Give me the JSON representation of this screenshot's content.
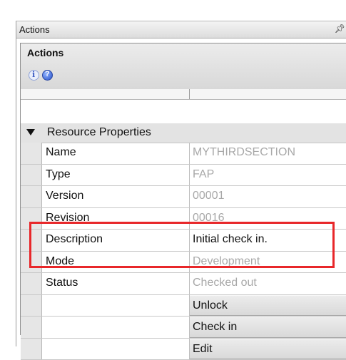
{
  "window": {
    "title": "Actions",
    "pin_icon": "pin-icon"
  },
  "panel": {
    "title": "Actions",
    "toolbar_icons": [
      "info-icon",
      "help-icon"
    ]
  },
  "category": {
    "label": "Resource Properties",
    "expanded": true
  },
  "properties": [
    {
      "name": "Name",
      "value": "MYTHIRDSECTION"
    },
    {
      "name": "Type",
      "value": "FAP"
    },
    {
      "name": "Version",
      "value": "00001"
    },
    {
      "name": "Revision",
      "value": "00016"
    },
    {
      "name": "Description",
      "value": "Initial check in."
    },
    {
      "name": "Mode",
      "value": "Development"
    },
    {
      "name": "Status",
      "value": "Checked out"
    }
  ],
  "actions": [
    {
      "label": "Unlock"
    },
    {
      "label": "Check in"
    },
    {
      "label": "Edit"
    }
  ],
  "colors": {
    "highlight": "#e8272a",
    "value_text": "#a8a8a8"
  }
}
